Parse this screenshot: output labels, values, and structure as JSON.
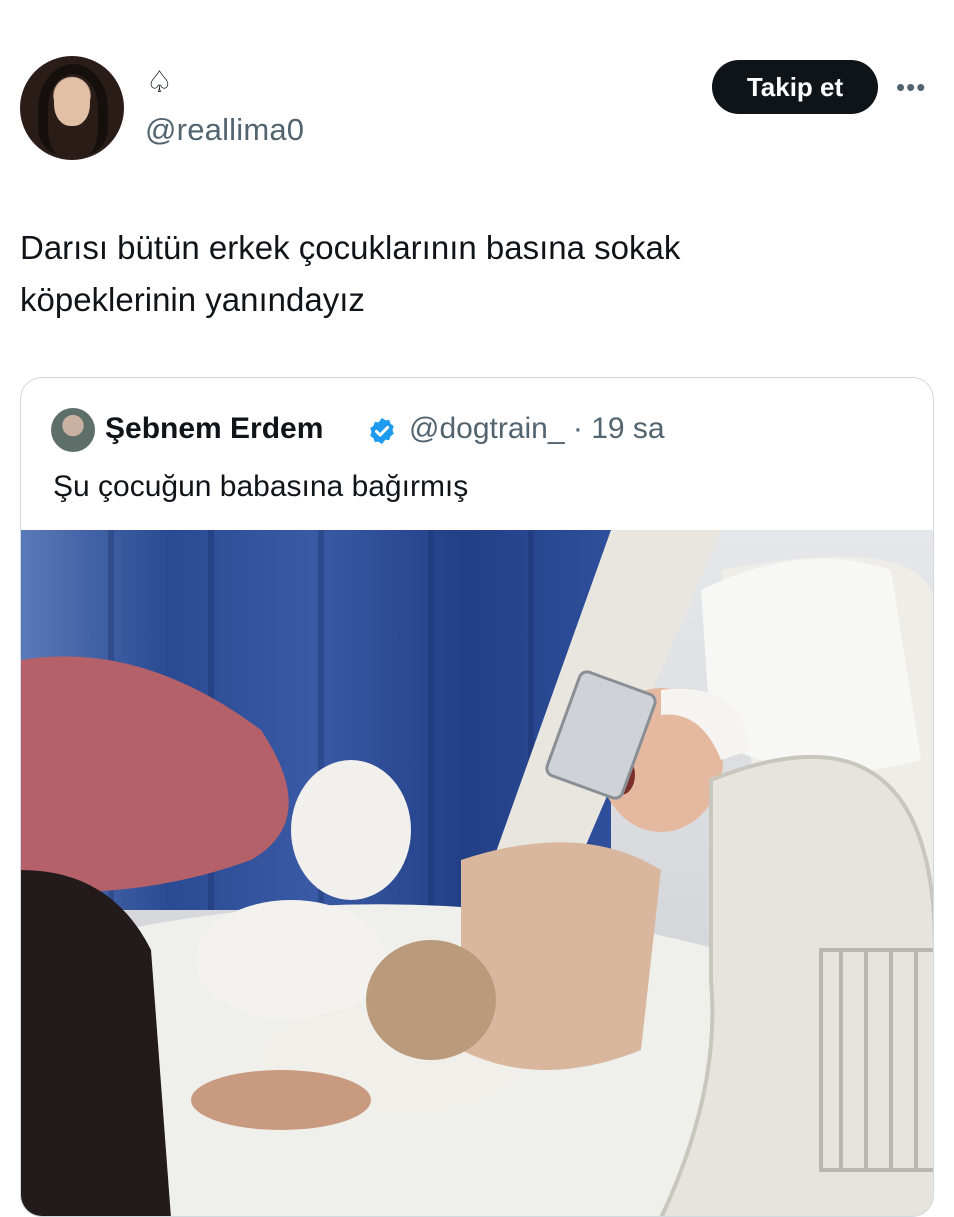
{
  "author": {
    "display_name": "♤",
    "handle": "@reallima0"
  },
  "actions": {
    "follow_label": "Takip et",
    "more_label": "•••"
  },
  "tweet": {
    "text_line1": "Darısı bütün erkek çocuklarının basına sokak",
    "text_line2": "köpeklerinin yanındayız"
  },
  "quoted_tweet": {
    "name": "Şebnem Erdem",
    "handle_time": "@dogtrain_ · 19 sa",
    "text": "Şu çocuğun babasına bağırmış",
    "media_description_icon": "photo"
  },
  "colors": {
    "text_primary": "#0f1419",
    "text_secondary": "#536471",
    "verified_blue": "#1d9bf0",
    "border": "#cfd9de"
  }
}
